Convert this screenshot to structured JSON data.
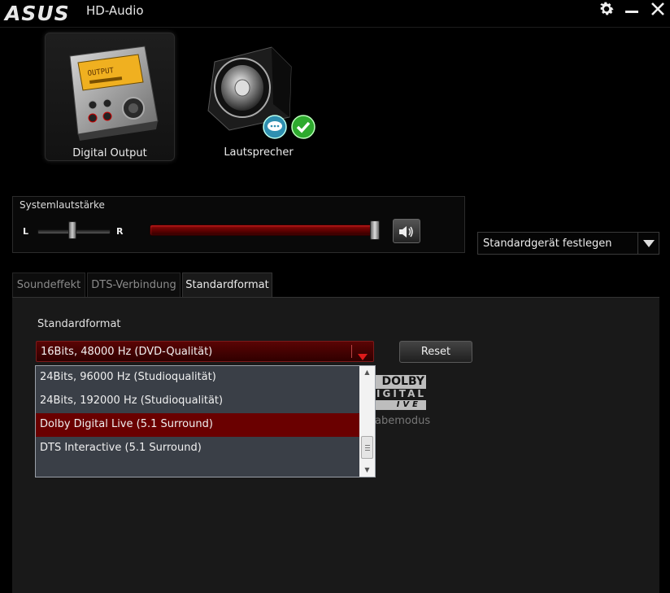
{
  "app": {
    "logo": "ASUS",
    "title": "HD-Audio"
  },
  "titlebar": {
    "settings_icon": "gear-icon",
    "minimize_icon": "minimize-icon",
    "close_icon": "close-icon"
  },
  "devices": [
    {
      "label": "Digital Output",
      "icon": "digital-output-device-icon",
      "selected": true
    },
    {
      "label": "Lautsprecher",
      "icon": "speaker-device-icon",
      "badges": [
        "chat-bubble-icon",
        "checkmark-icon"
      ]
    }
  ],
  "system_volume": {
    "label": "Systemlautstärke",
    "balance_left": "L",
    "balance_right": "R",
    "balance_level": 0.5,
    "volume_level": 1.0,
    "mute_icon": "speaker-volume-icon"
  },
  "default_device": {
    "label": "Standardgerät festlegen"
  },
  "tabs": [
    {
      "label": "Soundeffekt",
      "active": false
    },
    {
      "label": "DTS-Verbindung",
      "active": false
    },
    {
      "label": "Standardformat",
      "active": true
    }
  ],
  "standard_format": {
    "label": "Standardformat",
    "selected": "16Bits, 48000 Hz (DVD-Qualität)",
    "reset_label": "Reset",
    "options": [
      "24Bits, 96000 Hz (Studioqualität)",
      "24Bits, 192000 Hz (Studioqualität)",
      "Dolby Digital Live (5.1 Surround)",
      "DTS Interactive (5.1 Surround)"
    ],
    "highlighted_option_index": 2
  },
  "dolby_logo": {
    "line1": "DOLBY",
    "line2": "IGITAL",
    "line3": "IVE"
  },
  "mode_text": "abemodus",
  "colors": {
    "accent_red": "#6a0000",
    "background": "#000000",
    "panel": "#191919"
  }
}
